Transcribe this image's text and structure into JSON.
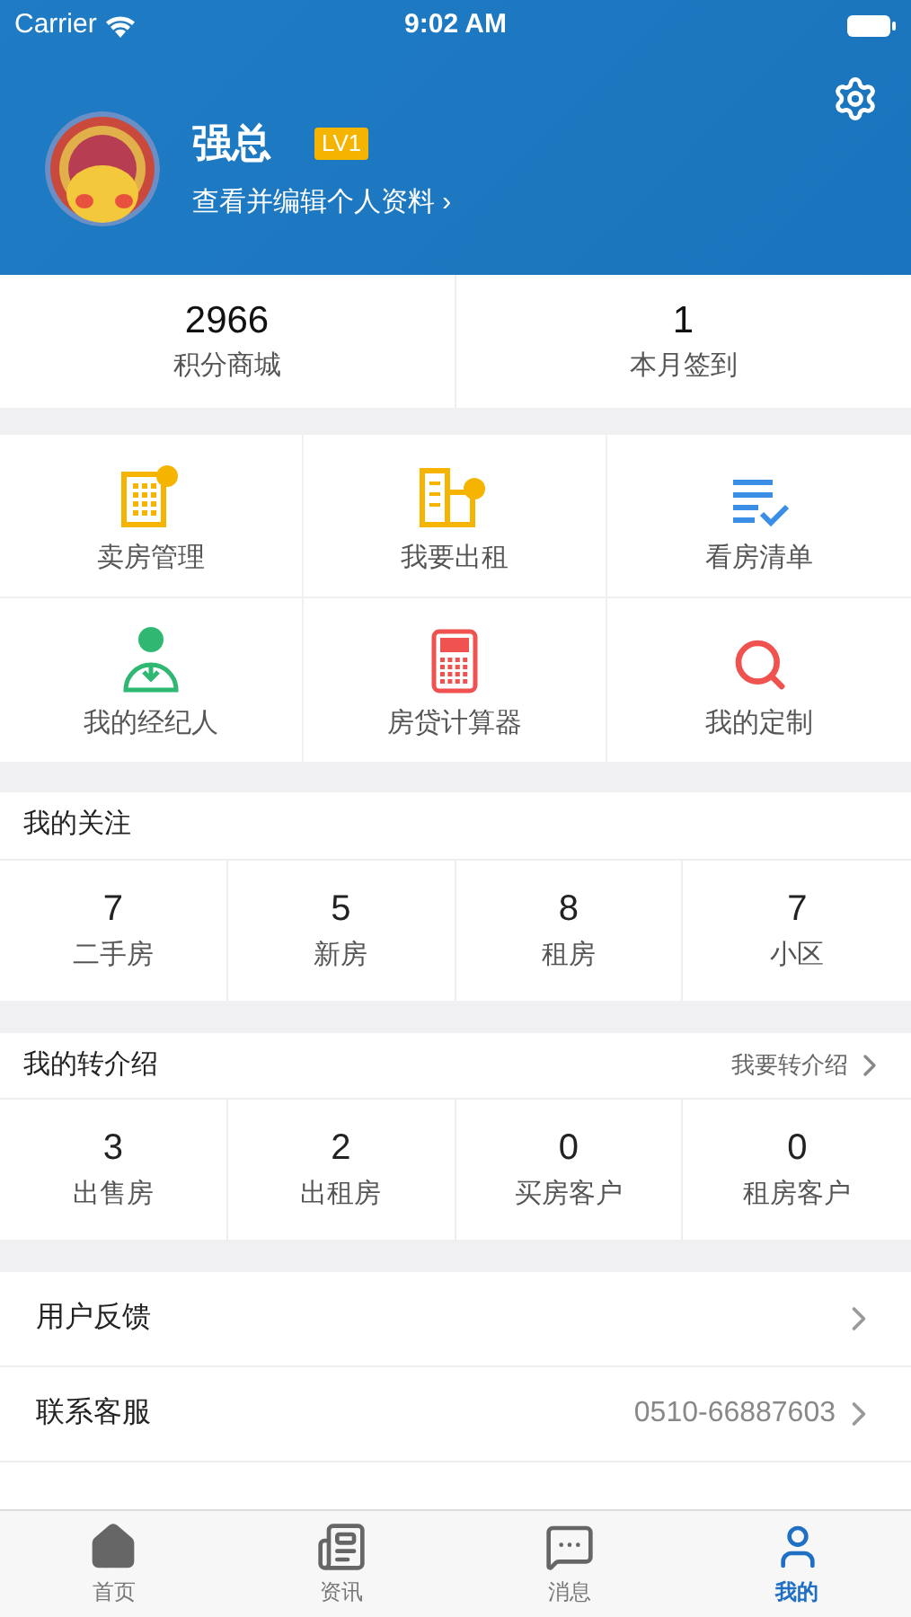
{
  "status_bar": {
    "carrier": "Carrier",
    "time": "9:02 AM"
  },
  "profile": {
    "name": "强总",
    "level_badge": "LV1",
    "edit_link": "查看并编辑个人资料 ›"
  },
  "stats": [
    {
      "value": "2966",
      "label": "积分商城"
    },
    {
      "value": "1",
      "label": "本月签到"
    }
  ],
  "tools": [
    {
      "kind": "sell",
      "label": "卖房管理"
    },
    {
      "kind": "rent",
      "label": "我要出租"
    },
    {
      "kind": "list",
      "label": "看房清单"
    },
    {
      "kind": "agent",
      "label": "我的经纪人"
    },
    {
      "kind": "calculator",
      "label": "房贷计算器"
    },
    {
      "kind": "search",
      "label": "我的定制"
    }
  ],
  "follows": {
    "title": "我的关注",
    "items": [
      {
        "value": "7",
        "label": "二手房"
      },
      {
        "value": "5",
        "label": "新房"
      },
      {
        "value": "8",
        "label": "租房"
      },
      {
        "value": "7",
        "label": "小区"
      }
    ]
  },
  "referrals": {
    "title": "我的转介绍",
    "action": "我要转介绍",
    "items": [
      {
        "value": "3",
        "label": "出售房"
      },
      {
        "value": "2",
        "label": "出租房"
      },
      {
        "value": "0",
        "label": "买房客户"
      },
      {
        "value": "0",
        "label": "租房客户"
      }
    ]
  },
  "menu": [
    {
      "label": "用户反馈"
    },
    {
      "label": "联系客服",
      "value": "0510-66887603"
    }
  ],
  "tab_bar": [
    {
      "kind": "home",
      "label": "首页",
      "selected": false
    },
    {
      "kind": "news",
      "label": "资讯",
      "selected": false
    },
    {
      "kind": "message",
      "label": "消息",
      "selected": false
    },
    {
      "kind": "user",
      "label": "我的",
      "selected": true
    }
  ]
}
